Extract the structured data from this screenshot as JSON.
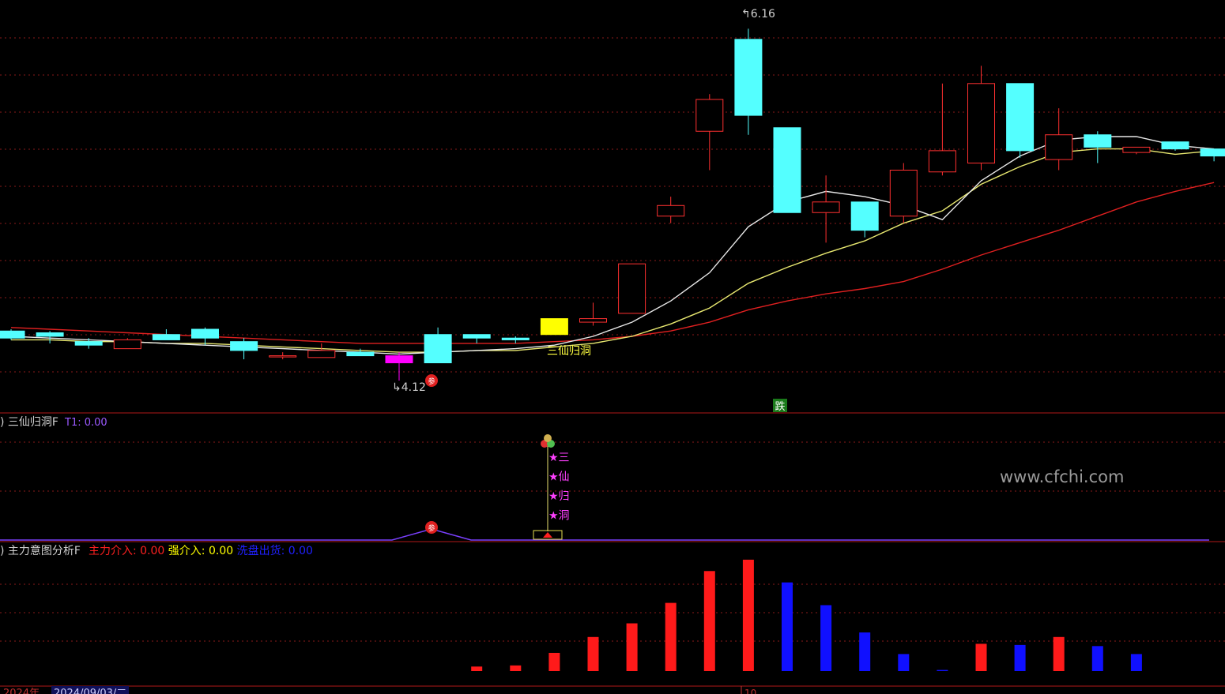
{
  "header": {
    "title": "",
    "ma_texts": []
  },
  "main_panel": {
    "high_label": "6.16",
    "low_label": "4.12",
    "signal_label": "三仙归洞",
    "tag_label": "跌",
    "can_label": "参"
  },
  "indicator1": {
    "title": "三仙归洞F",
    "value_label": "T1: 0.00",
    "vertical_chars": [
      "三",
      "仙",
      "归",
      "洞"
    ],
    "watermark": "www.cfchi.com"
  },
  "indicator2": {
    "title": "主力意图分析F",
    "legend": [
      {
        "label": "主力介入: 0.00",
        "color": "#ff2020"
      },
      {
        "label": "强介入: 0.00",
        "color": "#ffff00"
      },
      {
        "label": "洗盘出货: 0.00",
        "color": "#2020ff"
      }
    ]
  },
  "footer": {
    "year_label": "2024年",
    "date_label": "2024/09/03/二",
    "day_tick": "10"
  },
  "colors": {
    "up": "#ff3030",
    "down": "#54ffff",
    "ma_white": "#e8e8e8",
    "ma_yellow": "#e8e870",
    "ma_red": "#e02020",
    "grid": "#8a1a1a"
  },
  "chart_data": {
    "type": "candlestick",
    "candles": [
      {
        "o": 4.45,
        "c": 4.41,
        "h": 4.46,
        "l": 4.4
      },
      {
        "o": 4.44,
        "c": 4.42,
        "h": 4.45,
        "l": 4.38
      },
      {
        "o": 4.39,
        "c": 4.37,
        "h": 4.41,
        "l": 4.35
      },
      {
        "o": 4.35,
        "c": 4.4,
        "h": 4.41,
        "l": 4.35
      },
      {
        "o": 4.43,
        "c": 4.4,
        "h": 4.46,
        "l": 4.4
      },
      {
        "o": 4.46,
        "c": 4.41,
        "h": 4.47,
        "l": 4.37
      },
      {
        "o": 4.39,
        "c": 4.34,
        "h": 4.41,
        "l": 4.29
      },
      {
        "o": 4.31,
        "c": 4.31,
        "h": 4.33,
        "l": 4.29
      },
      {
        "o": 4.3,
        "c": 4.34,
        "h": 4.38,
        "l": 4.3
      },
      {
        "o": 4.33,
        "c": 4.31,
        "h": 4.35,
        "l": 4.31
      },
      {
        "o": 4.31,
        "c": 4.27,
        "h": 4.33,
        "l": 4.17
      },
      {
        "o": 4.43,
        "c": 4.27,
        "h": 4.47,
        "l": 4.27
      },
      {
        "o": 4.43,
        "c": 4.41,
        "h": 4.43,
        "l": 4.38
      },
      {
        "o": 4.41,
        "c": 4.4,
        "h": 4.42,
        "l": 4.38
      },
      {
        "o": 4.43,
        "c": 4.52,
        "h": 4.52,
        "l": 4.43
      },
      {
        "o": 4.5,
        "c": 4.52,
        "h": 4.61,
        "l": 4.48
      },
      {
        "o": 4.55,
        "c": 4.83,
        "h": 4.83,
        "l": 4.55
      },
      {
        "o": 5.1,
        "c": 5.16,
        "h": 5.21,
        "l": 5.06
      },
      {
        "o": 5.58,
        "c": 5.76,
        "h": 5.79,
        "l": 5.36
      },
      {
        "o": 6.1,
        "c": 5.67,
        "h": 6.16,
        "l": 5.56
      },
      {
        "o": 5.6,
        "c": 5.12,
        "h": 5.6,
        "l": 5.12
      },
      {
        "o": 5.12,
        "c": 5.18,
        "h": 5.33,
        "l": 4.95
      },
      {
        "o": 5.18,
        "c": 5.02,
        "h": 5.18,
        "l": 4.98
      },
      {
        "o": 5.1,
        "c": 5.36,
        "h": 5.4,
        "l": 5.06
      },
      {
        "o": 5.35,
        "c": 5.47,
        "h": 5.85,
        "l": 5.33
      },
      {
        "o": 5.4,
        "c": 5.85,
        "h": 5.95,
        "l": 5.36
      },
      {
        "o": 5.85,
        "c": 5.47,
        "h": 5.85,
        "l": 5.43
      },
      {
        "o": 5.42,
        "c": 5.56,
        "h": 5.71,
        "l": 5.36
      },
      {
        "o": 5.56,
        "c": 5.49,
        "h": 5.58,
        "l": 5.4
      },
      {
        "o": 5.46,
        "c": 5.49,
        "h": 5.49,
        "l": 5.45
      },
      {
        "o": 5.52,
        "c": 5.48,
        "h": 5.52,
        "l": 5.47
      },
      {
        "o": 5.48,
        "c": 5.44,
        "h": 5.48,
        "l": 5.41
      }
    ],
    "special": {
      "10": "magenta",
      "14": "yellow"
    },
    "ma_white": [
      4.42,
      4.41,
      4.4,
      4.39,
      4.38,
      4.37,
      4.36,
      4.35,
      4.34,
      4.33,
      4.32,
      4.33,
      4.34,
      4.35,
      4.37,
      4.42,
      4.5,
      4.62,
      4.78,
      5.04,
      5.18,
      5.24,
      5.21,
      5.16,
      5.08,
      5.3,
      5.44,
      5.53,
      5.55,
      5.55,
      5.5,
      5.48
    ],
    "ma_yellow": [
      4.4,
      4.4,
      4.39,
      4.39,
      4.38,
      4.38,
      4.37,
      4.36,
      4.35,
      4.34,
      4.33,
      4.33,
      4.34,
      4.34,
      4.36,
      4.38,
      4.42,
      4.49,
      4.58,
      4.72,
      4.81,
      4.89,
      4.96,
      5.06,
      5.13,
      5.28,
      5.38,
      5.46,
      5.48,
      5.48,
      5.45,
      5.47
    ],
    "ma_red": [
      4.47,
      4.46,
      4.45,
      4.44,
      4.43,
      4.42,
      4.41,
      4.4,
      4.39,
      4.38,
      4.38,
      4.38,
      4.38,
      4.38,
      4.39,
      4.4,
      4.42,
      4.45,
      4.5,
      4.57,
      4.62,
      4.66,
      4.69,
      4.73,
      4.8,
      4.88,
      4.95,
      5.02,
      5.1,
      5.18,
      5.24,
      5.29
    ],
    "ylim": [
      4.0,
      6.26
    ],
    "volume": [
      {
        "v": 0,
        "c": ""
      },
      {
        "v": 0,
        "c": ""
      },
      {
        "v": 0,
        "c": ""
      },
      {
        "v": 0,
        "c": ""
      },
      {
        "v": 0,
        "c": ""
      },
      {
        "v": 0,
        "c": ""
      },
      {
        "v": 0,
        "c": ""
      },
      {
        "v": 0,
        "c": ""
      },
      {
        "v": 0,
        "c": ""
      },
      {
        "v": 0,
        "c": ""
      },
      {
        "v": 0,
        "c": ""
      },
      {
        "v": 0,
        "c": ""
      },
      {
        "v": 4,
        "c": "red"
      },
      {
        "v": 5,
        "c": "red"
      },
      {
        "v": 16,
        "c": "red"
      },
      {
        "v": 30,
        "c": "red"
      },
      {
        "v": 42,
        "c": "red"
      },
      {
        "v": 60,
        "c": "red"
      },
      {
        "v": 88,
        "c": "red"
      },
      {
        "v": 98,
        "c": "red"
      },
      {
        "v": 78,
        "c": "blue"
      },
      {
        "v": 58,
        "c": "blue"
      },
      {
        "v": 34,
        "c": "blue"
      },
      {
        "v": 15,
        "c": "blue"
      },
      {
        "v": 1,
        "c": "blue"
      },
      {
        "v": 24,
        "c": "red"
      },
      {
        "v": 23,
        "c": "blue"
      },
      {
        "v": 30,
        "c": "red"
      },
      {
        "v": 22,
        "c": "blue"
      },
      {
        "v": 15,
        "c": "blue"
      },
      {
        "v": 0,
        "c": ""
      },
      {
        "v": 0,
        "c": ""
      }
    ],
    "vol_max": 100
  }
}
